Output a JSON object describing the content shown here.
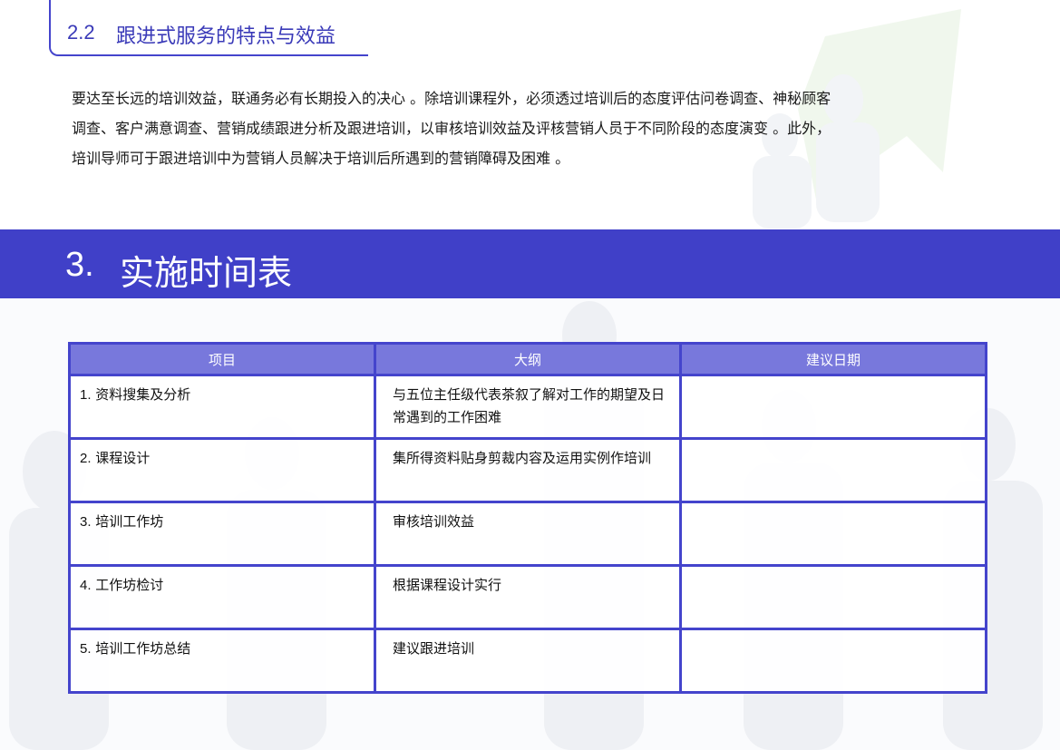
{
  "section_2_2": {
    "number": "2.2",
    "title": "跟进式服务的特点与效益"
  },
  "paragraph": {
    "lines": [
      "要达至长远的培训效益，联通务必有长期投入的决心 。除培训课程外，必须透过培训后的态度评估问卷调查、神秘顾客",
      "调查、客户满意调查、营销成绩跟进分析及跟进培训，以审核培训效益及评核营销人员于不同阶段的态度演变 。此外，",
      "培训导师可于跟进培训中为营销人员解决于培训后所遇到的营销障碍及困难 。"
    ]
  },
  "section_3": {
    "number": "3.",
    "title": "实施时间表"
  },
  "table": {
    "headers": [
      "项目",
      "大纲",
      "建议日期"
    ],
    "rows": [
      {
        "num": "1.",
        "item": "资料搜集及分析",
        "outline": "与五位主任级代表茶叙了解对工作的期望及日常遇到的工作困难",
        "date": ""
      },
      {
        "num": "2.",
        "item": "课程设计",
        "outline": "集所得资料贴身剪裁内容及运用实例作培训",
        "date": ""
      },
      {
        "num": "3.",
        "item": "培训工作坊",
        "outline": "审核培训效益",
        "date": ""
      },
      {
        "num": "4.",
        "item": "工作坊检讨",
        "outline": "根据课程设计实行",
        "date": ""
      },
      {
        "num": "5.",
        "item": "培训工作坊总结",
        "outline": "建议跟进培训",
        "date": ""
      }
    ]
  },
  "colors": {
    "accent": "#4040c8",
    "header_fill": "#7878dc",
    "border": "#4444cc"
  }
}
